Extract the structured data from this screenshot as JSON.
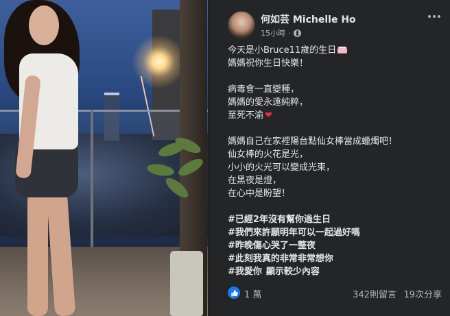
{
  "post": {
    "author": "何如芸 Michelle Ho",
    "time": "15小時",
    "text": {
      "l1": "今天是小Bruce11歲的生日",
      "l2": "媽媽祝你生日快樂！",
      "l3": "病毒會一直變種，",
      "l4": "媽媽的愛永遠純粹，",
      "l5": "至死不渝",
      "l6": "媽媽自己在家裡陽台點仙女棒當成蠟燭吧！",
      "l7": "仙女棒的火花是光，",
      "l8": "小小的火光可以變成光束，",
      "l9": "在黑夜是燈，",
      "l10": "在心中是盼望！",
      "h1": "#已經2年沒有幫你過生日",
      "h2": "#我們來許願明年可以一起過好嗎",
      "h3": "#昨晚傷心哭了一整夜",
      "h4": "#此刻我真的非常非常想你",
      "h5": "#我愛你",
      "see_more": "顯示較少內容"
    },
    "reactions": {
      "like_count": "1 萬"
    },
    "comments": "342則留言",
    "shares": "19次分享"
  },
  "icons": {
    "globe": "globe-icon",
    "more": "more-options-icon",
    "like": "like-icon",
    "cake": "birthday-cake-icon",
    "heart": "red-heart-icon"
  },
  "colors": {
    "background": "#242526",
    "text": "#e4e6eb",
    "secondary": "#b0b3b8",
    "like_blue": "#1877f2"
  }
}
